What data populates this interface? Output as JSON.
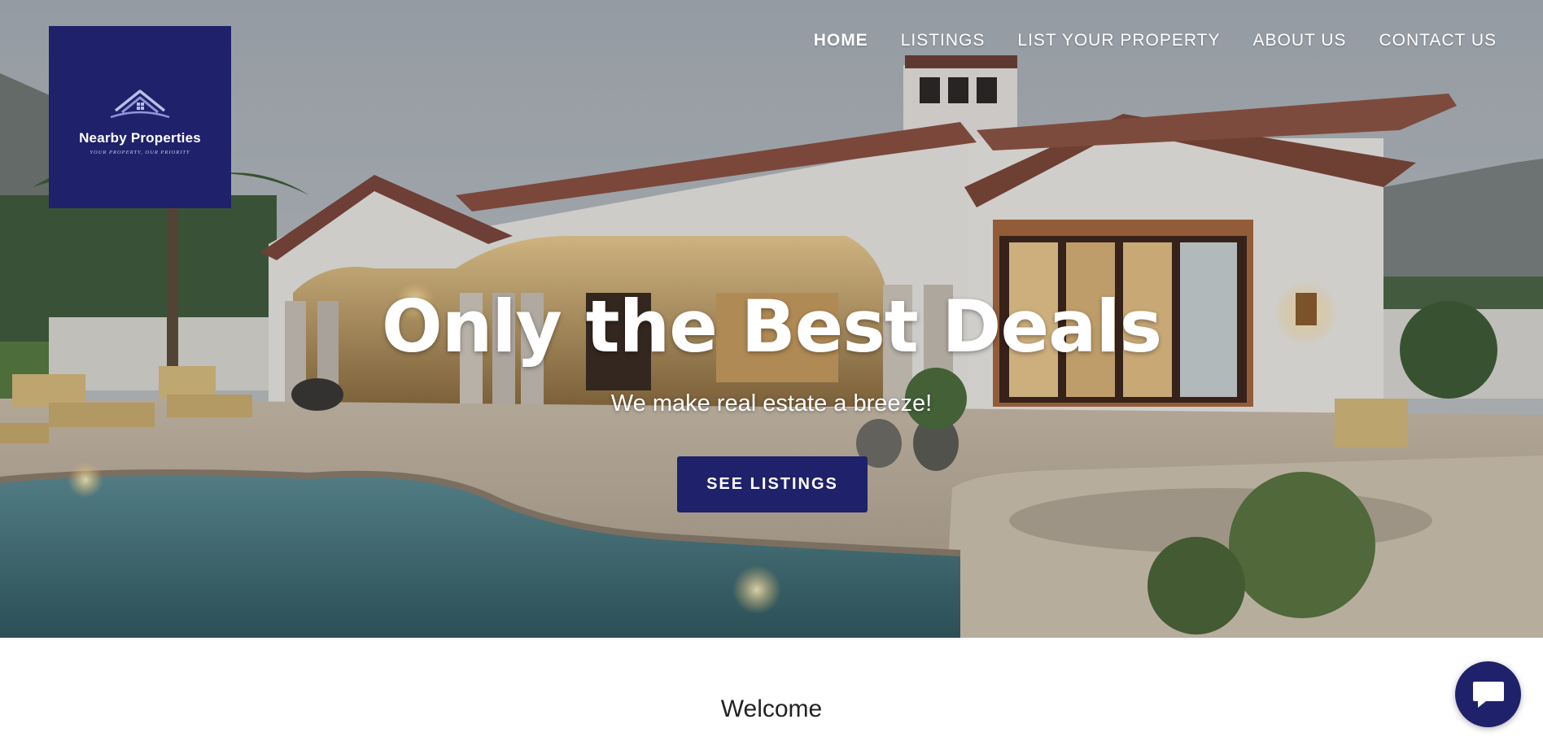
{
  "colors": {
    "brand": "#1f216b",
    "text_on_dark": "#ffffff",
    "body_text": "#222222"
  },
  "logo": {
    "name": "Nearby Properties",
    "tagline": "YOUR PROPERTY, OUR PRIORITY",
    "icon": "house-roof-icon"
  },
  "nav": {
    "items": [
      {
        "label": "HOME",
        "active": true
      },
      {
        "label": "LISTINGS",
        "active": false
      },
      {
        "label": "LIST YOUR PROPERTY",
        "active": false
      },
      {
        "label": "ABOUT US",
        "active": false
      },
      {
        "label": "CONTACT US",
        "active": false
      }
    ]
  },
  "hero": {
    "title": "Only the Best Deals",
    "subtitle": "We make real estate a breeze!",
    "cta_label": "SEE LISTINGS",
    "background": "luxury-villa-with-pool-photo"
  },
  "main": {
    "welcome": "Welcome"
  },
  "chat": {
    "icon": "chat-bubble-icon"
  }
}
